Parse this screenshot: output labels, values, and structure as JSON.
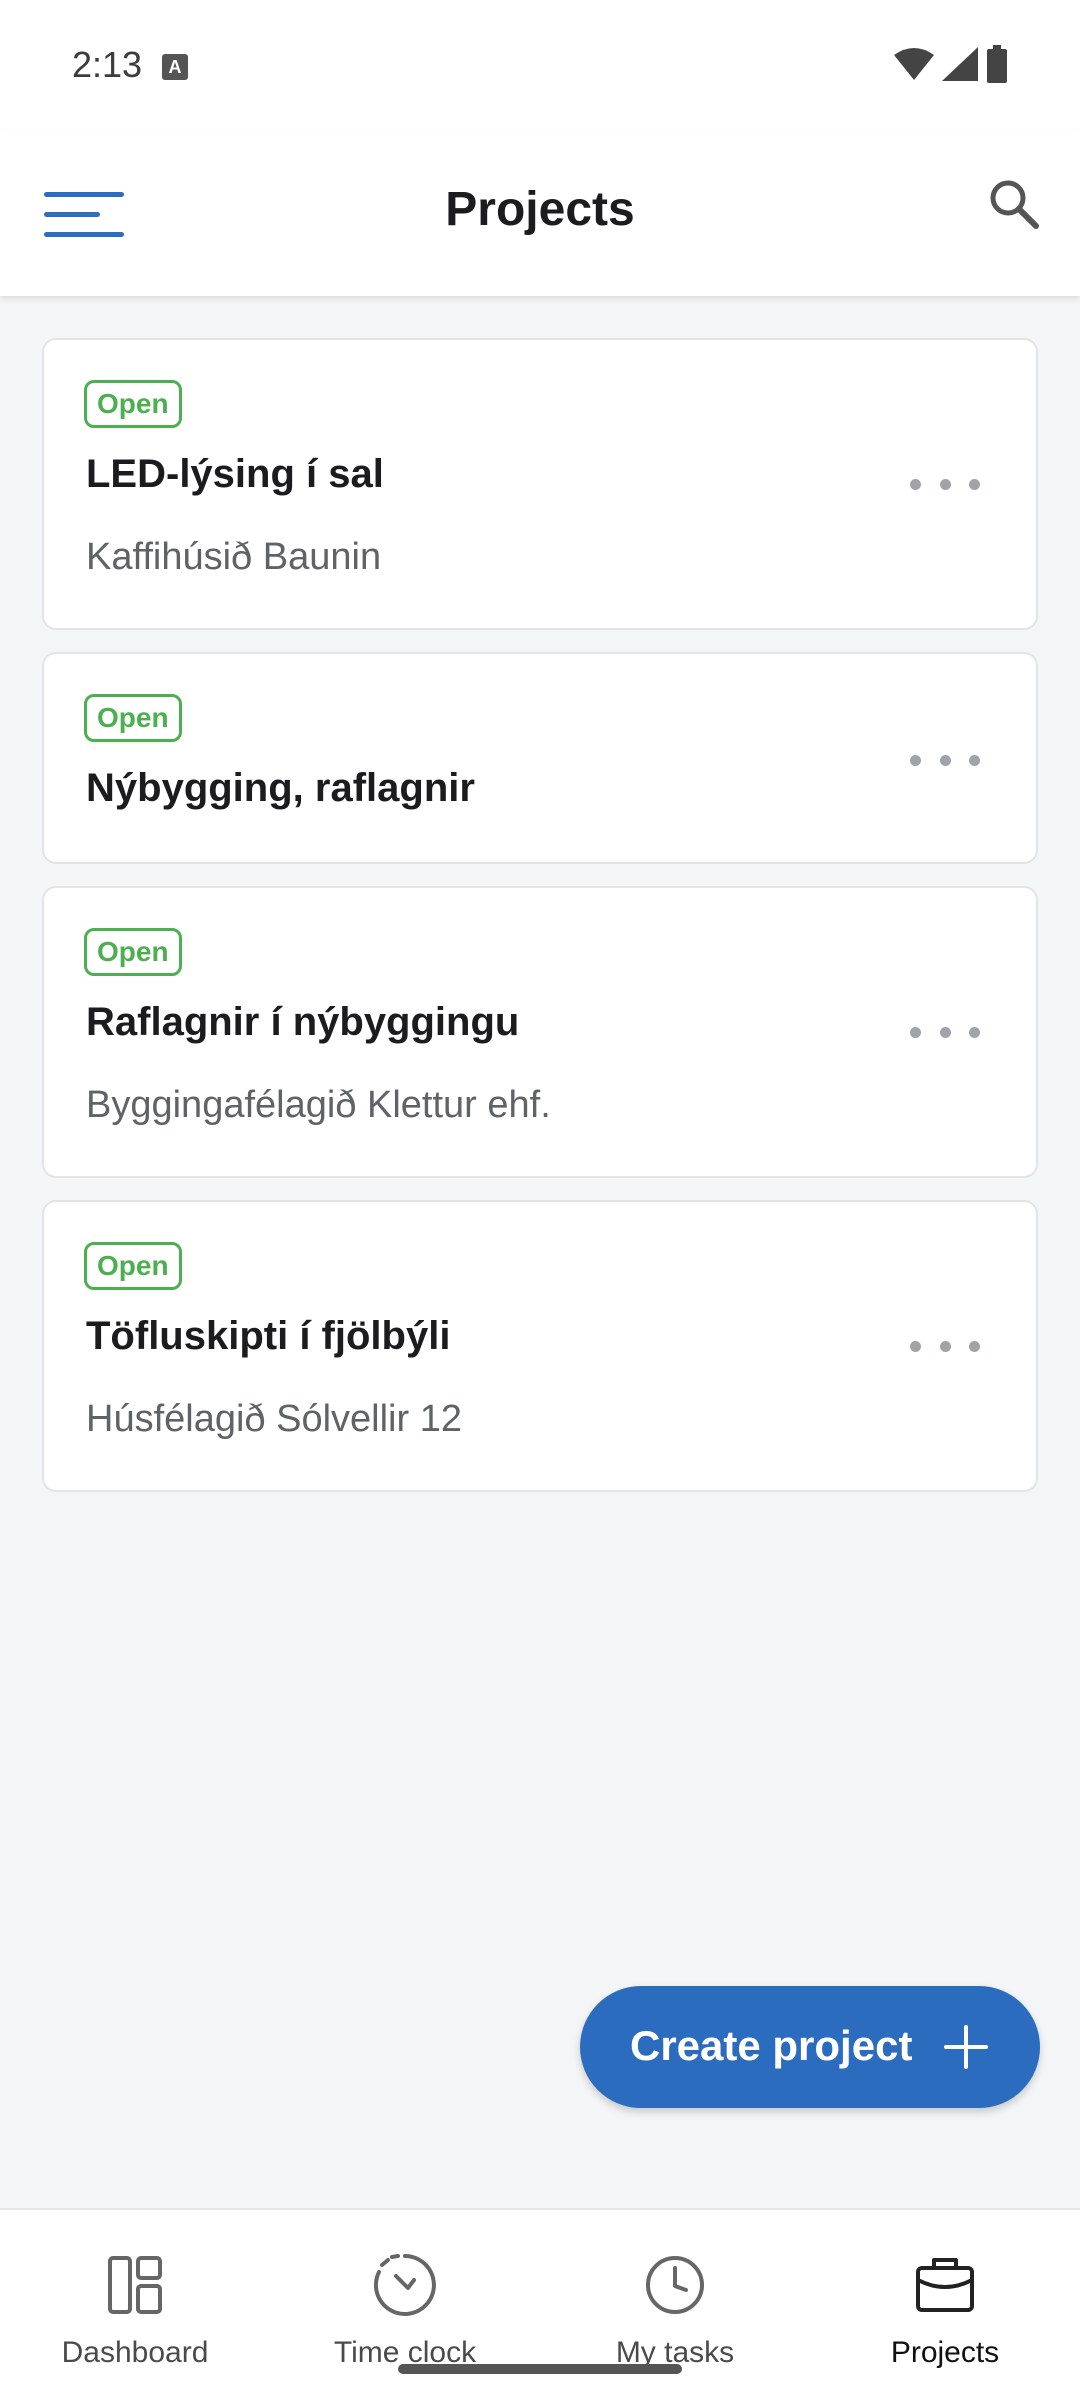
{
  "status_bar": {
    "time": "2:13",
    "notification_icon": "a-icon",
    "icons": [
      "wifi-icon",
      "signal-icon",
      "battery-icon"
    ]
  },
  "app_bar": {
    "title": "Projects",
    "menu_icon": "hamburger-menu-icon",
    "search_icon": "search-icon"
  },
  "projects": [
    {
      "status": "Open",
      "title": "LED-lýsing í sal",
      "client": "Kaffihúsið Baunin"
    },
    {
      "status": "Open",
      "title": "Nýbygging, raflagnir",
      "client": ""
    },
    {
      "status": "Open",
      "title": "Raflagnir í nýbyggingu",
      "client": "Byggingafélagið Klettur ehf."
    },
    {
      "status": "Open",
      "title": "Töfluskipti í fjölbýli",
      "client": "Húsfélagið Sólvellir 12"
    }
  ],
  "fab": {
    "label": "Create project",
    "icon": "plus-icon"
  },
  "bottom_nav": [
    {
      "label": "Dashboard",
      "icon": "dashboard-icon",
      "active": false
    },
    {
      "label": "Time clock",
      "icon": "time-clock-icon",
      "active": false
    },
    {
      "label": "My tasks",
      "icon": "clock-icon",
      "active": false
    },
    {
      "label": "Projects",
      "icon": "briefcase-icon",
      "active": true
    }
  ],
  "colors": {
    "accent": "#2c6cbe",
    "status_open": "#4caf50",
    "background": "#f4f5f7"
  }
}
